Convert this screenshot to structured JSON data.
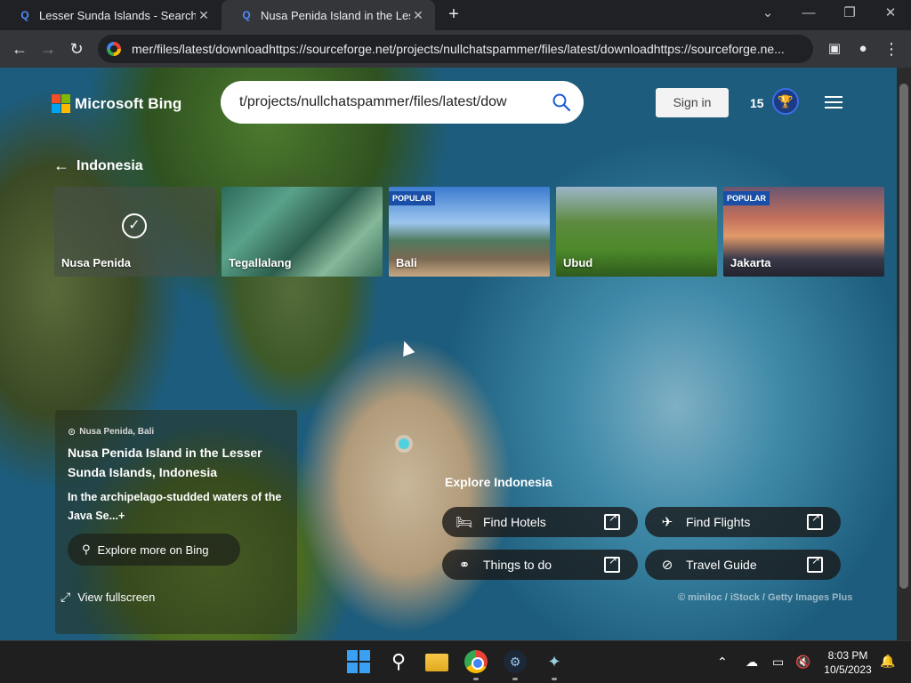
{
  "browser": {
    "tabs": [
      {
        "title": "Lesser Sunda Islands - Search",
        "active": false
      },
      {
        "title": "Nusa Penida Island in the Lesser",
        "active": true
      }
    ],
    "new_tab": "+",
    "url": "mer/files/latest/downloadhttps://sourceforge.net/projects/nullchatspammer/files/latest/downloadhttps://sourceforge.ne...",
    "window_controls": [
      "⌄",
      "—",
      "❐",
      "✕"
    ]
  },
  "bing": {
    "logo_text": "Microsoft Bing",
    "logo_colors": [
      "#f25022",
      "#7fba00",
      "#00a4ef",
      "#ffb900"
    ],
    "search_query": "t/projects/nullchatspammer/files/latest/dow",
    "sign_in": "Sign in",
    "points": "15",
    "accent": "#3b6ee8"
  },
  "back": {
    "label": "Indonesia"
  },
  "carousel": [
    {
      "name": "Nusa Penida",
      "badge": "",
      "selected": true
    },
    {
      "name": "Tegallalang",
      "badge": "",
      "selected": false
    },
    {
      "name": "Bali",
      "badge": "POPULAR",
      "selected": false
    },
    {
      "name": "Ubud",
      "badge": "",
      "selected": false
    },
    {
      "name": "Jakarta",
      "badge": "POPULAR",
      "selected": false
    }
  ],
  "info": {
    "location": "Nusa Penida, Bali",
    "title": "Nusa Penida Island in the Lesser Sunda Islands, Indonesia",
    "description": "In the archipelago-studded waters of the Java Se...",
    "plus": "+",
    "explore_more": "Explore more on Bing",
    "view_fullscreen": "View fullscreen"
  },
  "explore": {
    "title": "Explore Indonesia",
    "buttons": [
      {
        "label": "Find Hotels",
        "icon": "bed-icon"
      },
      {
        "label": "Find Flights",
        "icon": "plane-icon"
      },
      {
        "label": "Things to do",
        "icon": "binoculars-icon"
      },
      {
        "label": "Travel Guide",
        "icon": "compass-icon"
      }
    ],
    "credit": "© miniloc / iStock / Getty Images Plus"
  },
  "taskbar": {
    "time": "8:03 PM",
    "date": "10/5/2023"
  }
}
